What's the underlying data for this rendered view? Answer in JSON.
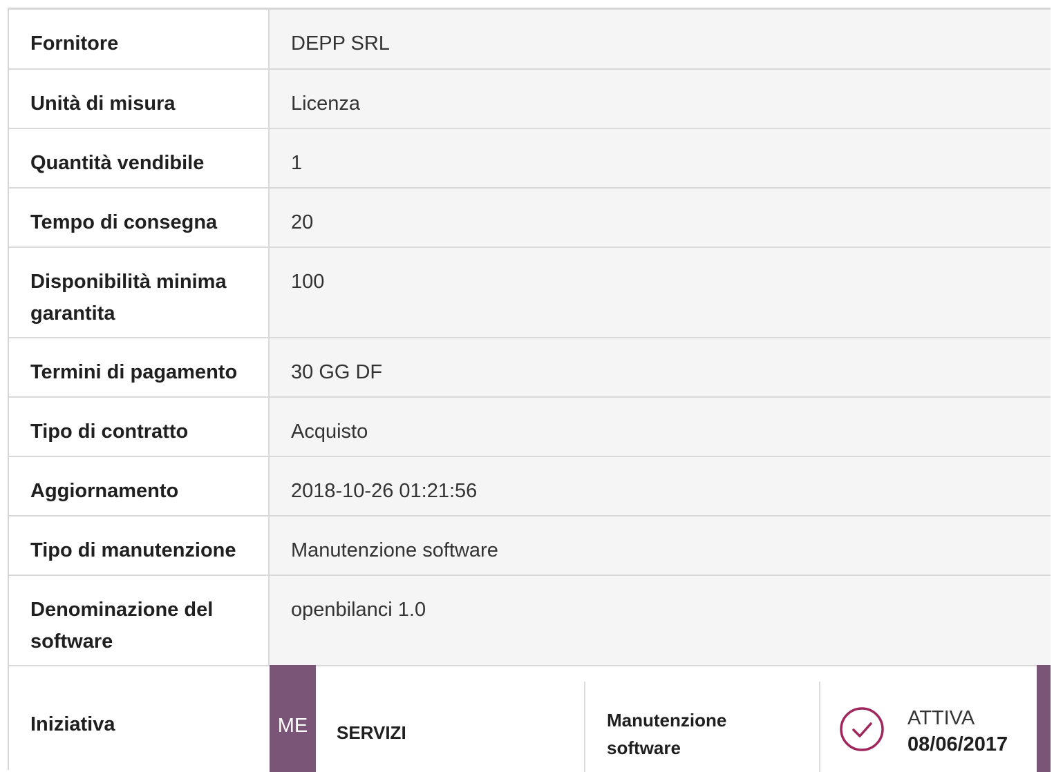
{
  "rows": [
    {
      "label": "Fornitore",
      "value": "DEPP SRL"
    },
    {
      "label": "Unità di misura",
      "value": "Licenza"
    },
    {
      "label": "Quantità vendibile",
      "value": "1"
    },
    {
      "label": "Tempo di consegna",
      "value": "20"
    },
    {
      "label": "Disponibilità minima garantita",
      "value": "100"
    },
    {
      "label": "Termini di pagamento",
      "value": "30 GG DF"
    },
    {
      "label": "Tipo di contratto",
      "value": "Acquisto"
    },
    {
      "label": "Aggiornamento",
      "value": "2018-10-26 01:21:56"
    },
    {
      "label": "Tipo di manutenzione",
      "value": "Manutenzione software"
    },
    {
      "label": "Denominazione del software",
      "value": "openbilanci 1.0"
    }
  ],
  "iniziativa": {
    "label": "Iniziativa",
    "badge": "ME",
    "category": "SERVIZI",
    "subcategory": "Manutenzione software",
    "status": "ATTIVA",
    "date": "08/06/2017",
    "icon": "check-circle-icon",
    "accent_color": "#7a5577",
    "icon_color": "#a0275d"
  }
}
